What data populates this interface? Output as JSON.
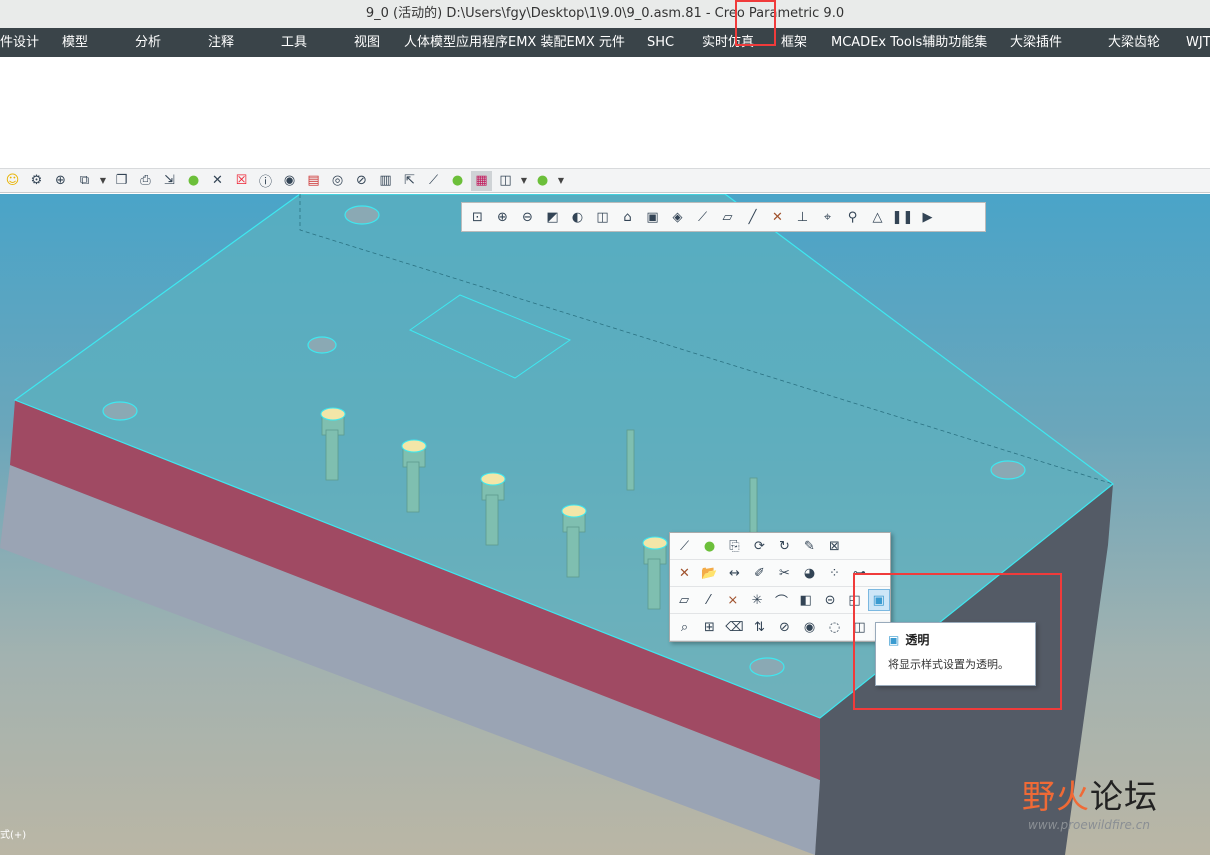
{
  "window": {
    "title": "9_0 (活动的) D:\\Users\\fgy\\Desktop\\1\\9.0\\9_0.asm.81 - Creo Parametric 9.0"
  },
  "menu": [
    "件设计",
    "模型",
    "分析",
    "注释",
    "工具",
    "视图",
    "人体模型应用程序EMX 装配EMX 元件",
    "SHC",
    "实时仿真",
    "框架",
    "MCADEx Tools辅助功能集",
    "大梁插件",
    "大梁齿轮",
    "WJT"
  ],
  "toolbar": {
    "icons": [
      "smiley-icon",
      "gear-icon",
      "target-icon",
      "window-icon",
      "copy-icon",
      "print-icon",
      "export-icon",
      "sphere-icon",
      "close-x-icon",
      "red-close-icon",
      "info-icon",
      "save-view-icon",
      "pdf-icon",
      "eye-icon",
      "hide-icon",
      "assembly-icon",
      "move-icon",
      "ruler-icon",
      "sphere-icon",
      "color-bars-icon",
      "cube-icon",
      "sphere-icon"
    ]
  },
  "view_toolbar": {
    "icons": [
      "refit-icon",
      "zoom-in-icon",
      "zoom-out-icon",
      "repaint-icon",
      "shading-icon",
      "display-style-icon",
      "saved-views-icon",
      "view-manager-icon",
      "perspective-icon",
      "datum-display-icon",
      "plane-icon",
      "axis-icon",
      "point-icon",
      "csys-icon",
      "spin-center-icon",
      "annotation-icon",
      "simulation-icon",
      "pause-icon",
      "next-icon"
    ]
  },
  "mini_toolbar": {
    "rows": [
      [
        "ruler-icon",
        "sphere-icon",
        "sketch-icon",
        "regenerate-icon",
        "rotate-icon",
        "edit-icon",
        "datum-filter-icon"
      ],
      [
        "point-icon",
        "open-icon",
        "dimension-icon",
        "appearance-icon",
        "cut-icon",
        "shade-icon",
        "pattern-icon",
        "tree-icon"
      ],
      [
        "plane-icon",
        "line-icon",
        "cross-icon",
        "intersect-icon",
        "curve-icon",
        "solid-icon",
        "section-icon",
        "hidden-icon",
        "transparent-icon"
      ],
      [
        "inspect-icon",
        "add-part-icon",
        "eraser-icon",
        "align-icon",
        "hide-icon",
        "show-icon",
        "unhide-icon",
        "cube-icon"
      ]
    ]
  },
  "tooltip": {
    "title": "透明",
    "description": "将显示样式设置为透明。"
  },
  "status": {
    "text": "式(+)"
  },
  "watermark": {
    "cn_a": "野火",
    "cn_b": "论坛",
    "url": "www.proewildfire.cn"
  },
  "colors": {
    "accent_red": "#f03b3b",
    "edge_cyan": "#3ee8f0",
    "menubar": "#3a4449"
  }
}
